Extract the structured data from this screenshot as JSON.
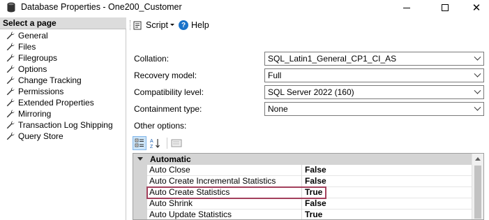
{
  "window": {
    "title": "Database Properties - One200_Customer",
    "minimize_icon": "minimize-icon",
    "maximize_icon": "maximize-icon",
    "close_icon": "close-icon",
    "close_glyph": "✕"
  },
  "sidebar": {
    "header": "Select a page",
    "items": [
      {
        "label": "General"
      },
      {
        "label": "Files"
      },
      {
        "label": "Filegroups"
      },
      {
        "label": "Options"
      },
      {
        "label": "Change Tracking"
      },
      {
        "label": "Permissions"
      },
      {
        "label": "Extended Properties"
      },
      {
        "label": "Mirroring"
      },
      {
        "label": "Transaction Log Shipping"
      },
      {
        "label": "Query Store"
      }
    ]
  },
  "toolbar": {
    "script_label": "Script",
    "help_label": "Help",
    "help_glyph": "?"
  },
  "form": {
    "collation_label": "Collation:",
    "collation_value": "SQL_Latin1_General_CP1_CI_AS",
    "recovery_label": "Recovery model:",
    "recovery_value": "Full",
    "compat_label": "Compatibility level:",
    "compat_value": "SQL Server 2022 (160)",
    "containment_label": "Containment type:",
    "containment_value": "None",
    "other_options_label": "Other options:"
  },
  "property_grid": {
    "category": "Automatic",
    "rows": [
      {
        "name": "Auto Close",
        "value": "False"
      },
      {
        "name": "Auto Create Incremental Statistics",
        "value": "False"
      },
      {
        "name": "Auto Create Statistics",
        "value": "True"
      },
      {
        "name": "Auto Shrink",
        "value": "False"
      },
      {
        "name": "Auto Update Statistics",
        "value": "True"
      }
    ]
  },
  "colors": {
    "highlight_border": "#a3405c",
    "sidebar_header_bg": "#dcdcdc",
    "help_icon": "#1b73c9"
  }
}
